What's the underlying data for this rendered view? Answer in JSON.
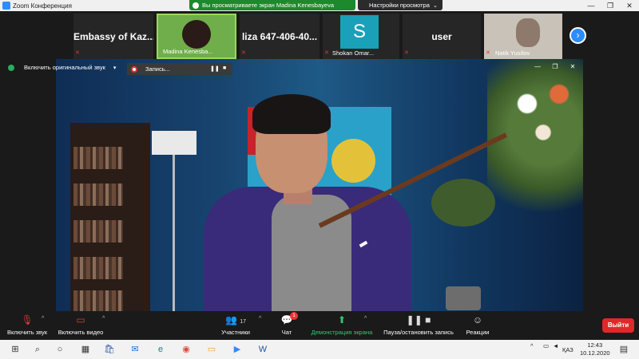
{
  "window": {
    "title": "Zoom Конференция",
    "controls": [
      "—",
      "❐",
      "✕"
    ]
  },
  "share_banner": {
    "text": "Вы просматриваете экран Madina Kenesbayeva",
    "view_options": "Настройки просмотра"
  },
  "participants": [
    {
      "big_name": "Embassy of Kaz...",
      "caption": ""
    },
    {
      "big_name": "",
      "caption": "Madina Kenesba..."
    },
    {
      "big_name": "liza 647-406-40...",
      "caption": ""
    },
    {
      "big_name": "",
      "caption": "Shokan Omar...",
      "avatar_letter": "S"
    },
    {
      "big_name": "user",
      "caption": ""
    },
    {
      "big_name": "",
      "caption": "Natik Yusifov"
    }
  ],
  "audio": {
    "original_sound_label": "Включить оригинальный звук"
  },
  "recording": {
    "label": "Запись..."
  },
  "toolbar": {
    "unmute": "Включить звук",
    "start_video": "Включить видео",
    "participants": "Участники",
    "participants_count": "17",
    "chat": "Чат",
    "chat_badge": "1",
    "share_screen": "Демонстрация экрана",
    "pause_recording": "Пауза/остановить запись",
    "reactions": "Реакции",
    "leave": "Выйти"
  },
  "taskbar": {
    "language": "ҚАЗ",
    "time": "12:43",
    "date": "10.12.2020"
  }
}
